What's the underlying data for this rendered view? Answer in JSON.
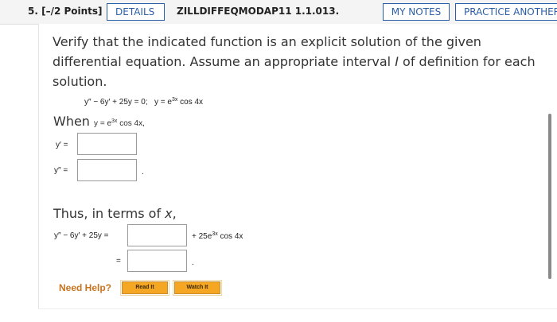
{
  "header": {
    "question_number": "5. [–/2 Points]",
    "details_label": "DETAILS",
    "problem_code": "ZILLDIFFEQMODAP11 1.1.013.",
    "my_notes_label": "MY NOTES",
    "practice_label": "PRACTICE ANOTHER"
  },
  "problem": {
    "prompt_start": "Verify that the indicated function is an explicit solution of the given differential equation. Assume an appropriate interval ",
    "interval_symbol": "I",
    "prompt_end": " of definition for each solution.",
    "equation": "y″ − 6y′ + 25y = 0;",
    "function_base": "y = e",
    "function_exp": "3x",
    "function_tail": " cos 4x",
    "when_label": "When",
    "when_base": "y = e",
    "when_exp": "3x",
    "when_tail": " cos 4x,"
  },
  "inputs": {
    "y_prime_label": "y′ =",
    "y_prime_value": "",
    "y_double_prime_label": "y″ =",
    "y_double_prime_value": "",
    "y_double_prime_suffix": "."
  },
  "thus": {
    "label_start": "Thus, in terms of ",
    "label_var": "x",
    "label_end": ",",
    "lhs": "y″ − 6y′ + 25y =",
    "box1_value": "",
    "plus_term_base": "+ 25e",
    "plus_term_exp": "3x",
    "plus_term_tail": " cos 4x",
    "equals": "=",
    "box2_value": "",
    "box2_suffix": "."
  },
  "help": {
    "label": "Need Help?",
    "read_it": "Read It",
    "watch_it": "Watch It"
  }
}
